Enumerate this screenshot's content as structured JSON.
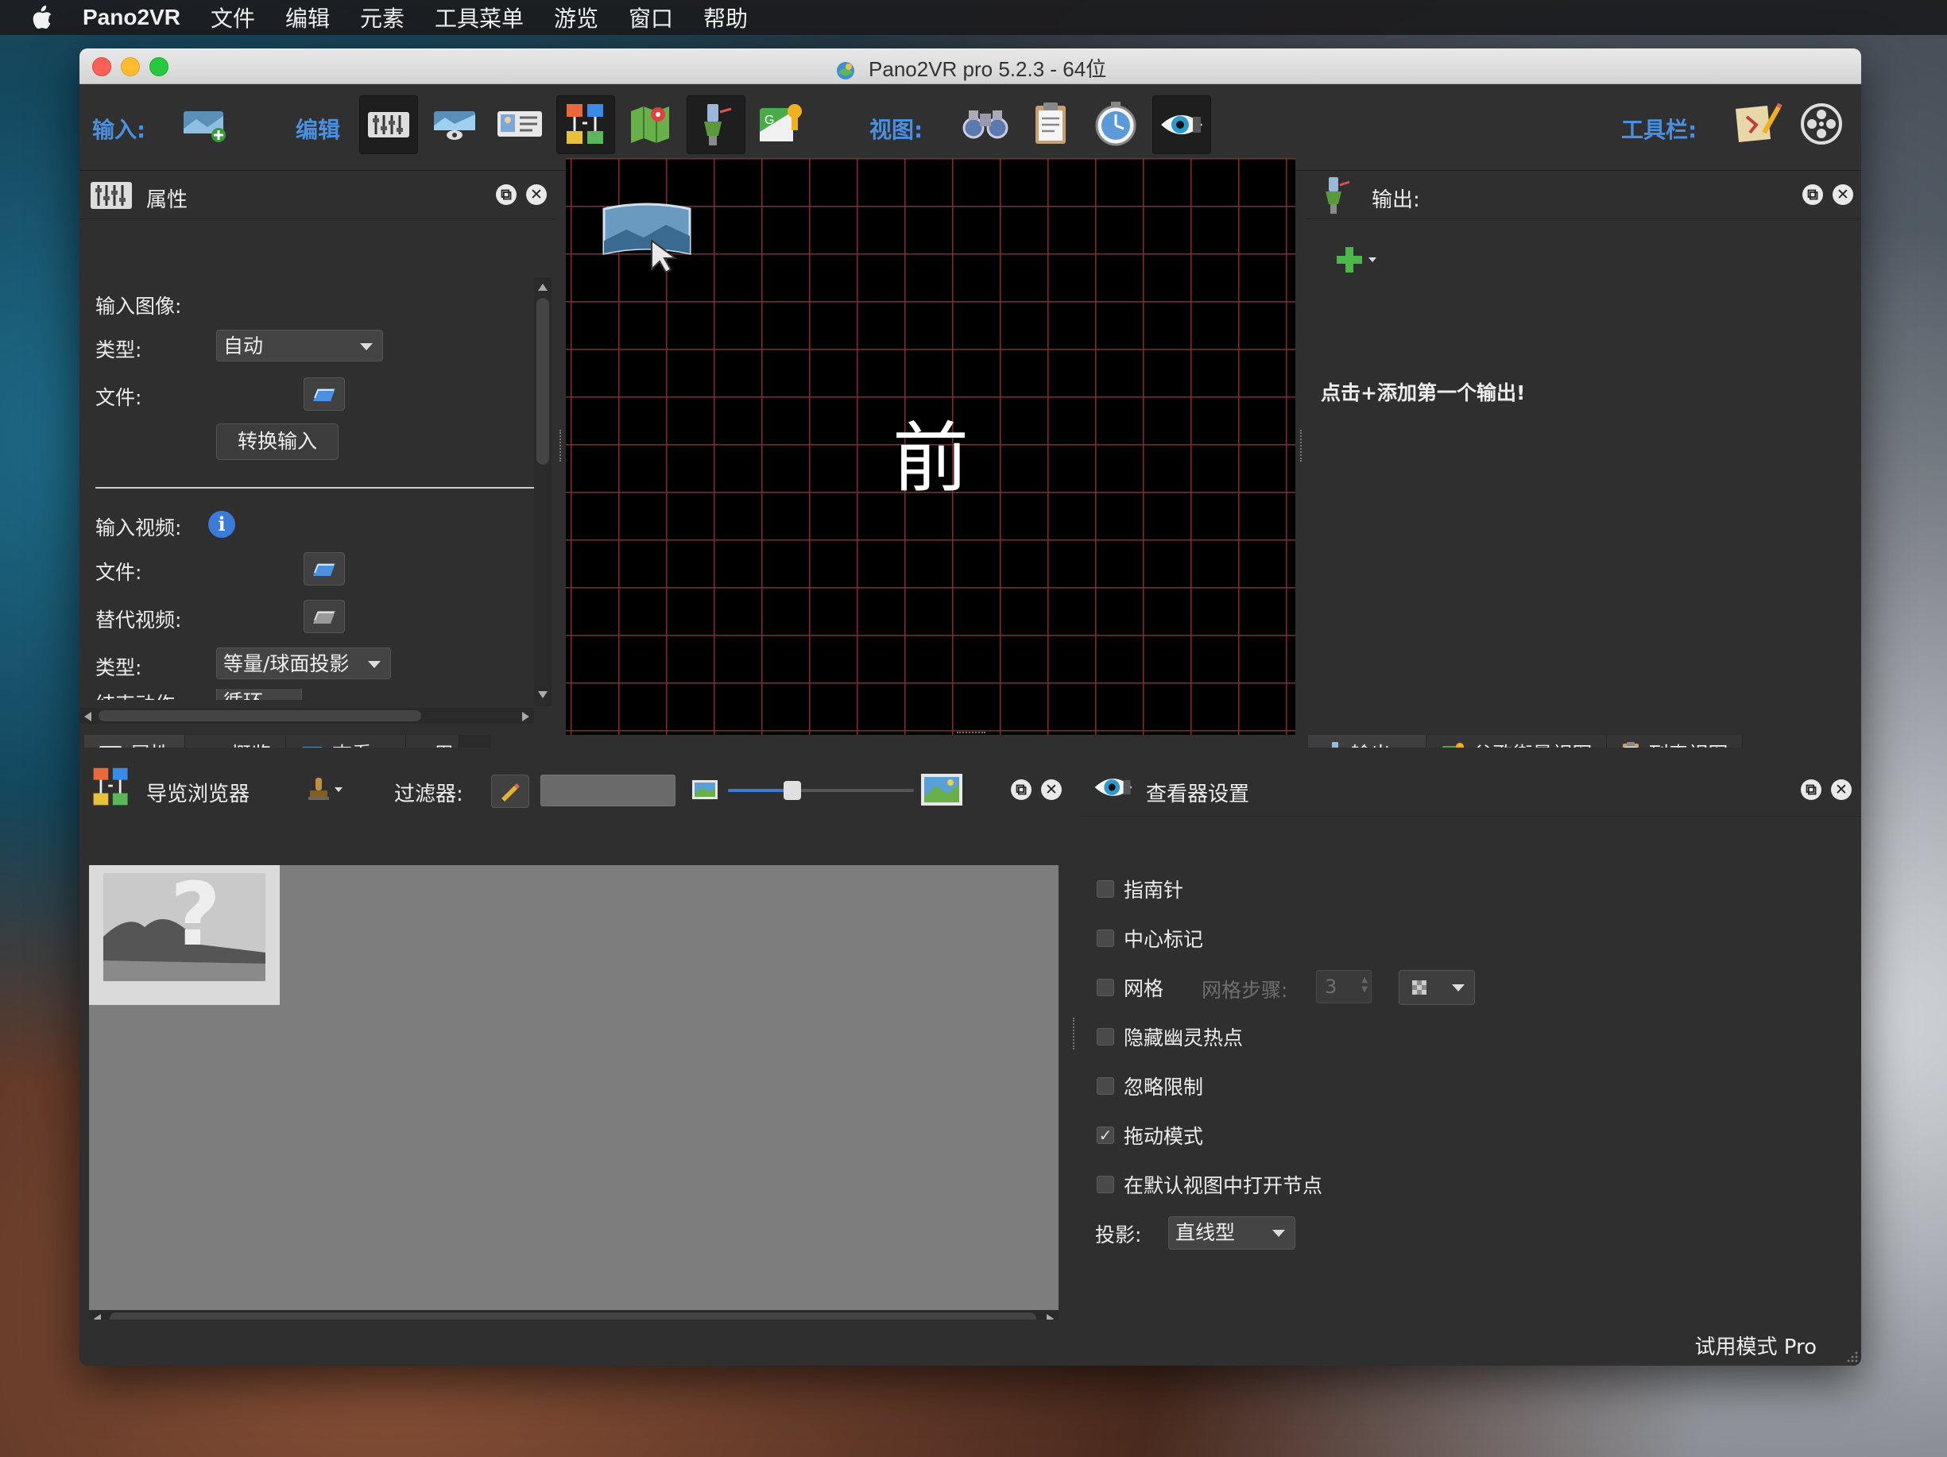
{
  "menubar": {
    "app_name": "Pano2VR",
    "items": [
      "文件",
      "编辑",
      "元素",
      "工具菜单",
      "游览",
      "窗口",
      "帮助"
    ]
  },
  "window": {
    "title": "Pano2VR pro 5.2.3 - 64位"
  },
  "toolbar": {
    "input_label": "输入:",
    "edit_label": "编辑",
    "view_label": "视图:",
    "toolbar_label": "工具栏:"
  },
  "properties_panel": {
    "title": "属性",
    "input_image_label": "输入图像:",
    "type_label": "类型:",
    "type_value": "自动",
    "file_label": "文件:",
    "convert_button": "转换输入",
    "input_video_label": "输入视频:",
    "video_file_label": "文件:",
    "alt_video_label": "替代视频:",
    "video_type_label": "类型:",
    "video_type_value": "等量/球面投影",
    "end_action_label": "结束动作:",
    "end_action_value": "循环",
    "tabs": [
      "属性",
      "概览",
      "查看...",
      "用"
    ]
  },
  "viewer": {
    "face_label": "前"
  },
  "output_panel": {
    "title": "输出:",
    "hint": "点击+添加第一个输出!",
    "tabs": [
      "输出:",
      "谷歌街景视图",
      "列表视图"
    ]
  },
  "tour_browser": {
    "title": "导览浏览器",
    "filter_label": "过滤器:",
    "filter_value": "",
    "thumbnail_size": 0.3
  },
  "viewer_settings": {
    "title": "查看器设置",
    "compass": {
      "label": "指南针",
      "checked": false
    },
    "center_mark": {
      "label": "中心标记",
      "checked": false
    },
    "grid": {
      "label": "网格",
      "checked": false
    },
    "grid_step_label": "网格步骤:",
    "grid_step_value": "3",
    "hide_ghost": {
      "label": "隐藏幽灵热点",
      "checked": false
    },
    "ignore_limits": {
      "label": "忽略限制",
      "checked": false
    },
    "drag_mode": {
      "label": "拖动模式",
      "checked": true
    },
    "open_default": {
      "label": "在默认视图中打开节点",
      "checked": false
    },
    "projection_label": "投影:",
    "projection_value": "直线型"
  },
  "status": {
    "text": "试用模式 Pro"
  },
  "colors": {
    "accent_blue": "#4a8fe0",
    "grid_line": "#8a2a34",
    "panel_bg": "#2f2f2f"
  }
}
